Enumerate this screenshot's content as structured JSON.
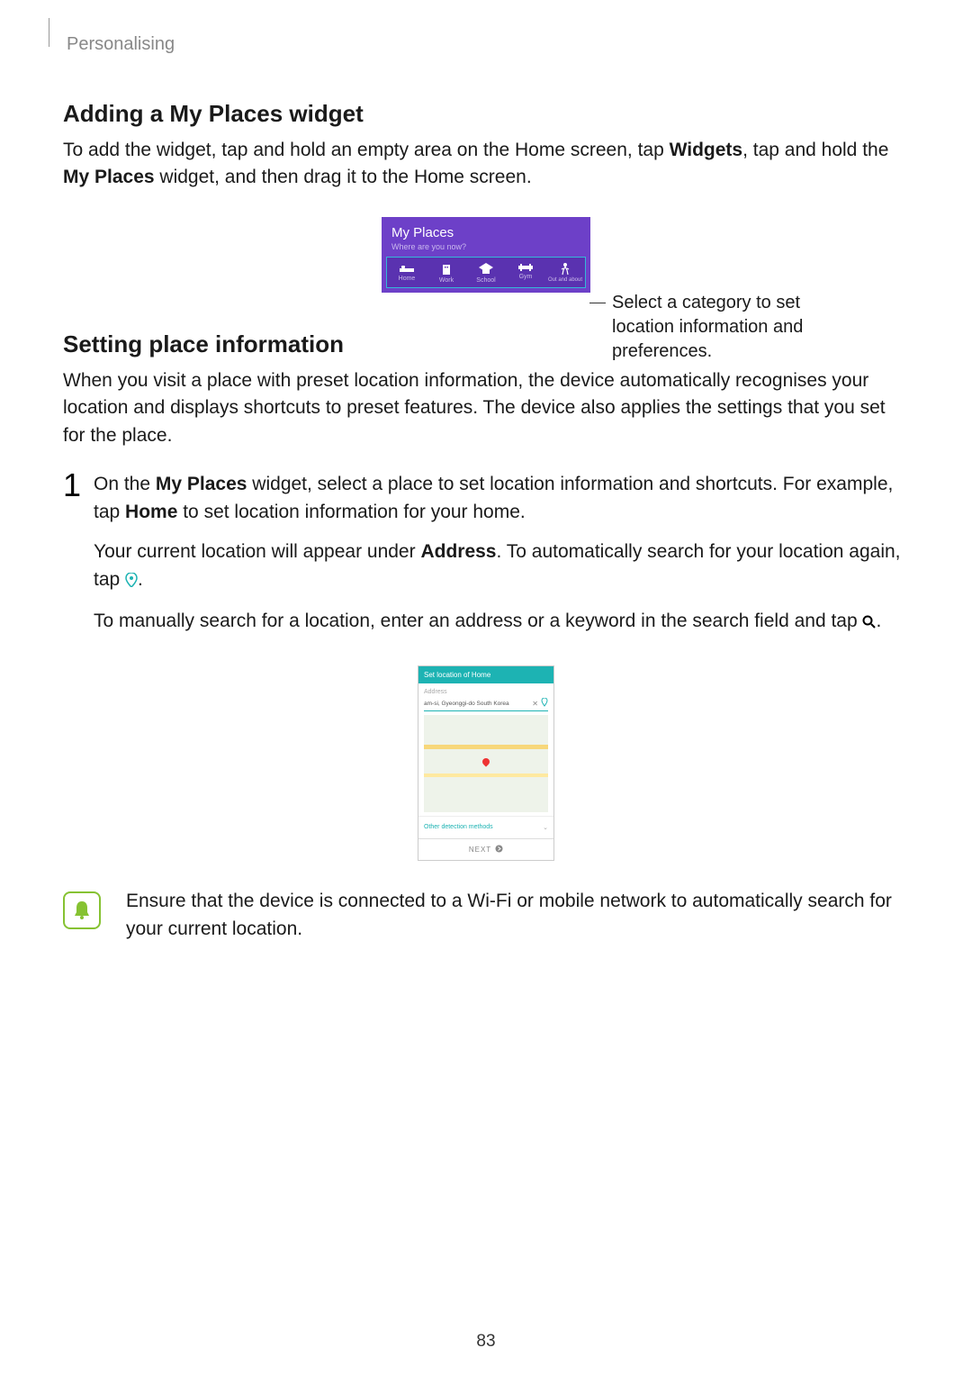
{
  "breadcrumb": "Personalising",
  "h_add_widget": "Adding a My Places widget",
  "p_add_widget_1a": "To add the widget, tap and hold an empty area on the Home screen, tap ",
  "p_add_widget_1b": "Widgets",
  "p_add_widget_1c": ", tap and hold the ",
  "p_add_widget_1d": "My Places",
  "p_add_widget_1e": " widget, and then drag it to the Home screen.",
  "widget": {
    "title": "My Places",
    "subtitle": "Where are you now?",
    "cats": [
      "Home",
      "Work",
      "School",
      "Gym",
      "Out and about"
    ]
  },
  "callout": "Select a category to set location information and preferences.",
  "h_setting": "Setting place information",
  "p_setting_intro": "When you visit a place with preset location information, the device automatically recognises your location and displays shortcuts to preset features. The device also applies the settings that you set for the place.",
  "step1_num": "1",
  "step1_1a": "On the ",
  "step1_1b": "My Places",
  "step1_1c": " widget, select a place to set location information and shortcuts. For example, tap ",
  "step1_1d": "Home",
  "step1_1e": " to set location information for your home.",
  "step1_2a": "Your current location will appear under ",
  "step1_2b": "Address",
  "step1_2c": ". To automatically search for your location again, tap ",
  "step1_2d": ".",
  "step1_3a": "To manually search for a location, enter an address or a keyword in the search field and tap ",
  "step1_3b": ".",
  "phone": {
    "top": "Set location of Home",
    "address_label": "Address",
    "address_value": "am-si, Gyeonggi-do South Korea",
    "other": "Other detection methods",
    "next": "NEXT"
  },
  "note": "Ensure that the device is connected to a Wi-Fi or mobile network to automatically search for your current location.",
  "page_number": "83"
}
